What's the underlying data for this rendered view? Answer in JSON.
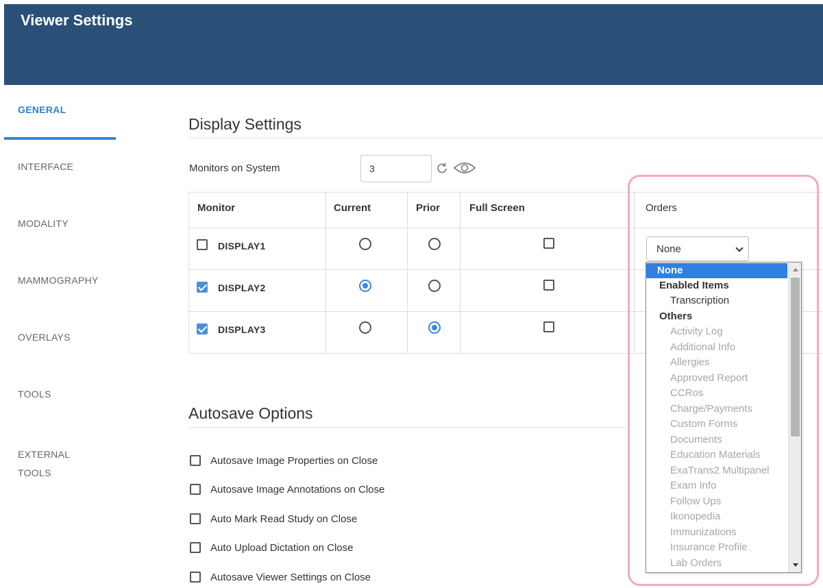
{
  "header": {
    "title": "Viewer Settings"
  },
  "sidebar": {
    "items": [
      {
        "label": "GENERAL",
        "active": true
      },
      {
        "label": "INTERFACE"
      },
      {
        "label": "MODALITY"
      },
      {
        "label": "MAMMOGRAPHY"
      },
      {
        "label": "OVERLAYS"
      },
      {
        "label": "TOOLS"
      },
      {
        "label_line1": "EXTERNAL",
        "label_line2": "TOOLS"
      }
    ]
  },
  "display_settings": {
    "title": "Display Settings",
    "monitors_label": "Monitors on System",
    "monitors_value": "3",
    "columns": [
      "Monitor",
      "Current",
      "Prior",
      "Full Screen",
      "Orders"
    ],
    "rows": [
      {
        "name": "DISPLAY1",
        "enabled": false,
        "current": false,
        "prior": false,
        "full_screen": false
      },
      {
        "name": "DISPLAY2",
        "enabled": true,
        "current": true,
        "prior": false,
        "full_screen": false
      },
      {
        "name": "DISPLAY3",
        "enabled": true,
        "current": false,
        "prior": true,
        "full_screen": false
      }
    ],
    "orders_select": {
      "value": "None"
    },
    "orders_dropdown": {
      "selected": "None",
      "group_enabled": "Enabled Items",
      "enabled_items": [
        "Transcription"
      ],
      "group_others": "Others",
      "other_items": [
        "Activity Log",
        "Additional Info",
        "Allergies",
        "Approved Report",
        "CCRos",
        "Charge/Payments",
        "Custom Forms",
        "Documents",
        "Education Materials",
        "ExaTrans2 Multipanel",
        "Exam Info",
        "Follow Ups",
        "Ikonopedia",
        "Immunizations",
        "Insurance Profile",
        "Lab Orders"
      ]
    }
  },
  "autosave": {
    "title": "Autosave Options",
    "options": [
      "Autosave Image Properties on Close",
      "Autosave Image Annotations on Close",
      "Auto Mark Read Study on Close",
      "Auto Upload Dictation on Close",
      "Autosave Viewer Settings on Close"
    ]
  },
  "colors": {
    "header_bg": "#2a5078",
    "accent": "#2f87d8",
    "highlight_border": "#f2a9c6"
  }
}
